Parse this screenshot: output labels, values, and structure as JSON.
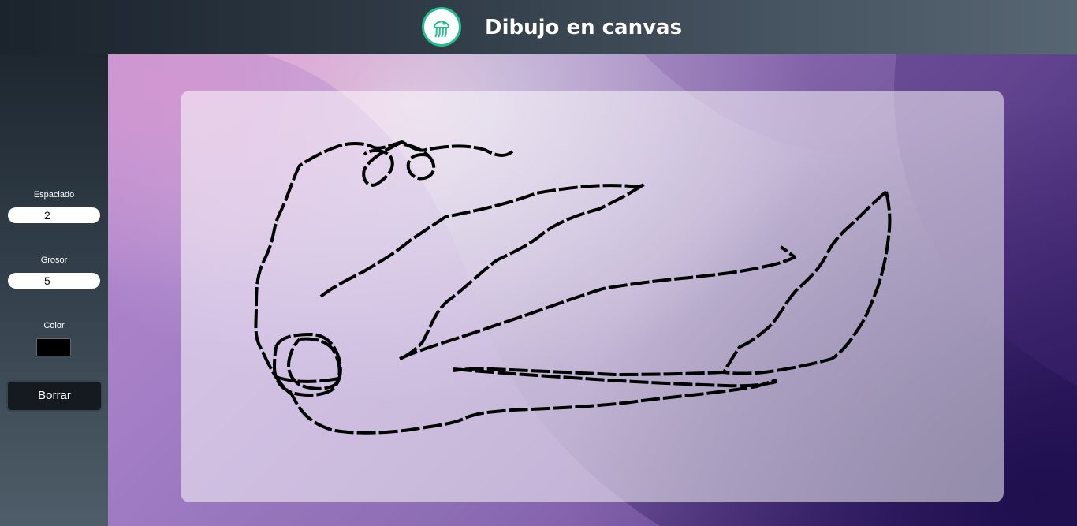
{
  "header": {
    "title": "Dibujo en canvas",
    "logo_icon": "jellyfish-icon"
  },
  "controls": {
    "spacing": {
      "label": "Espaciado",
      "value": "2"
    },
    "thickness": {
      "label": "Grosor",
      "value": "5"
    },
    "color": {
      "label": "Color",
      "value": "#000000"
    },
    "clear_button": "Borrar"
  },
  "colors": {
    "accent": "#22c08f",
    "stroke": "#000000"
  }
}
